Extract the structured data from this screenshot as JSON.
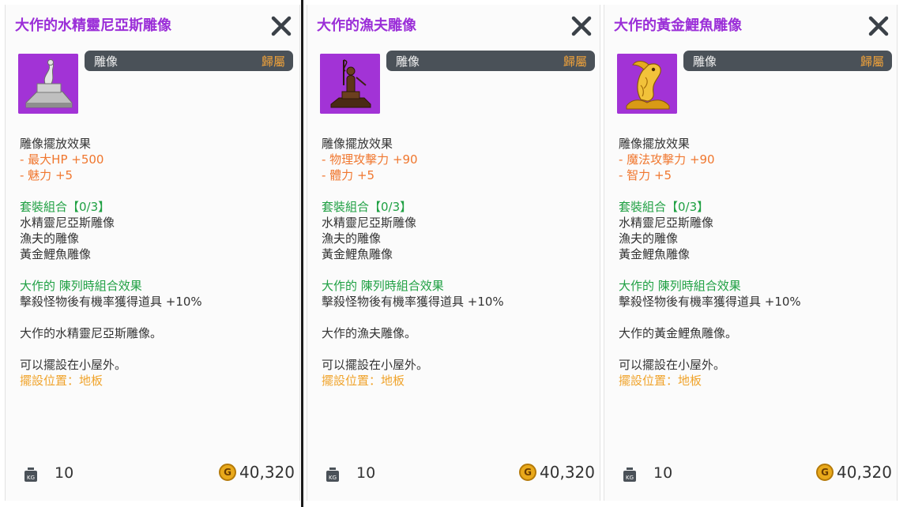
{
  "panels": [
    {
      "title": "大作的水精靈尼亞斯雕像",
      "category": "雕像",
      "binding": "歸屬",
      "icon": "water-spirit-statue-icon",
      "effect_heading": "雕像擺放效果",
      "effects": [
        "- 最大HP  +500",
        "- 魅力 +5"
      ],
      "set_heading": "套裝組合【0/3】",
      "set_items": [
        "水精靈尼亞斯雕像",
        "漁夫的雕像",
        "黃金鯉魚雕像"
      ],
      "combo_heading": "大作的 陳列時組合效果",
      "combo_effect": "擊殺怪物後有機率獲得道具 +10%",
      "description": "大作的水精靈尼亞斯雕像。",
      "placement_note": "可以擺設在小屋外。",
      "placement_location": "擺設位置：地板",
      "weight": "10",
      "price": "40,320"
    },
    {
      "title": "大作的漁夫雕像",
      "category": "雕像",
      "binding": "歸屬",
      "icon": "fisherman-statue-icon",
      "effect_heading": "雕像擺放效果",
      "effects": [
        "- 物理攻擊力 +90",
        "- 體力 +5"
      ],
      "set_heading": "套裝組合【0/3】",
      "set_items": [
        "水精靈尼亞斯雕像",
        "漁夫的雕像",
        "黃金鯉魚雕像"
      ],
      "combo_heading": "大作的 陳列時組合效果",
      "combo_effect": "擊殺怪物後有機率獲得道具 +10%",
      "description": "大作的漁夫雕像。",
      "placement_note": "可以擺設在小屋外。",
      "placement_location": "擺設位置：地板",
      "weight": "10",
      "price": "40,320"
    },
    {
      "title": "大作的黃金鯉魚雕像",
      "category": "雕像",
      "binding": "歸屬",
      "icon": "golden-carp-statue-icon",
      "effect_heading": "雕像擺放效果",
      "effects": [
        "- 魔法攻擊力 +90",
        "- 智力 +5"
      ],
      "set_heading": "套裝組合【0/3】",
      "set_items": [
        "水精靈尼亞斯雕像",
        "漁夫的雕像",
        "黃金鯉魚雕像"
      ],
      "combo_heading": "大作的 陳列時組合效果",
      "combo_effect": "擊殺怪物後有機率獲得道具 +10%",
      "description": "大作的黃金鯉魚雕像。",
      "placement_note": "可以擺設在小屋外。",
      "placement_location": "擺設位置：地板",
      "weight": "10",
      "price": "40,320"
    }
  ],
  "weight_icon": "kg-weight-icon",
  "coin_icon": "gold-coin-icon",
  "coin_letter": "G",
  "colors": {
    "title": "#9b2fd8",
    "thumb_bg": "#a233d6",
    "category_bar": "#4a5158",
    "binding": "#f2a33a",
    "effect": "#f0772f",
    "set_heading": "#1fa043",
    "placement": "#f0a32a",
    "coin": "#e9a91b"
  }
}
